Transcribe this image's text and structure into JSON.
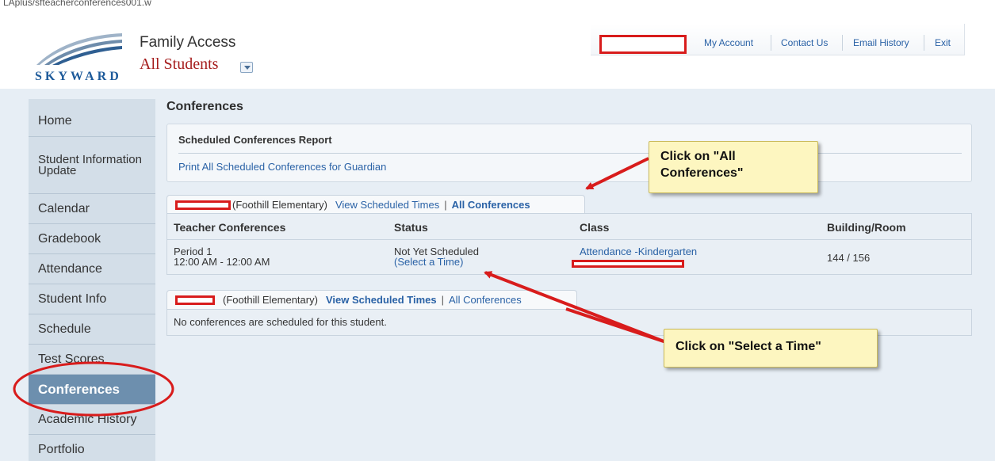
{
  "browser": {
    "url_fragment": "LAplus/sfteacherconferences001.w"
  },
  "header": {
    "logo_text": "SKYWARD",
    "app_title": "Family Access",
    "student_selector": "All Students"
  },
  "top_links": [
    {
      "label": "My Account"
    },
    {
      "label": "Contact Us"
    },
    {
      "label": "Email History"
    },
    {
      "label": "Exit"
    }
  ],
  "sidebar": {
    "items": [
      {
        "label": "Home"
      },
      {
        "label": "Student Information Update"
      },
      {
        "label": "Calendar"
      },
      {
        "label": "Gradebook"
      },
      {
        "label": "Attendance"
      },
      {
        "label": "Student Info"
      },
      {
        "label": "Schedule"
      },
      {
        "label": "Test Scores"
      },
      {
        "label": "Conferences"
      },
      {
        "label": "Academic History"
      },
      {
        "label": "Portfolio"
      }
    ]
  },
  "main": {
    "page_title": "Conferences",
    "report": {
      "title": "Scheduled Conferences Report",
      "link": "Print All Scheduled Conferences for Guardian"
    },
    "student1": {
      "school": "(Foothill Elementary)",
      "view_link": "View Scheduled Times",
      "separator": "|",
      "all_link": "All Conferences"
    },
    "table": {
      "headers": [
        "Teacher Conferences",
        "Status",
        "Class",
        "Building/Room"
      ],
      "row": {
        "period": "Period 1",
        "time": "12:00 AM - 12:00 AM",
        "status": "Not Yet Scheduled",
        "select_link": "(Select a Time)",
        "class": "Attendance -Kindergarten",
        "room": "144 / 156"
      }
    },
    "student2": {
      "school": "(Foothill Elementary)",
      "view_link": "View Scheduled Times",
      "separator": "|",
      "all_link": "All Conferences",
      "empty_message": "No conferences are scheduled for this student."
    }
  },
  "annotations": {
    "callout1": "Click on \"All Conferences\"",
    "callout2": "Click on \"Select a Time\"",
    "color": "#d81c1c"
  }
}
